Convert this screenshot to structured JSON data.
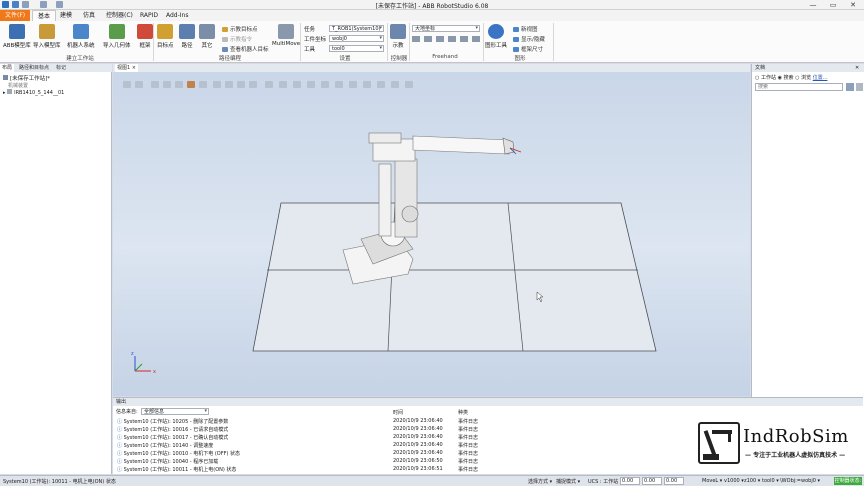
{
  "app": {
    "title": "[未保存工作站] - ABB RobotStudio 6.08"
  },
  "window": {
    "minimize": "—",
    "restore": "▭",
    "close": "✕"
  },
  "tabs": [
    "文件(F)",
    "基本",
    "建模",
    "仿真",
    "控制器(C)",
    "RAPID",
    "Add-Ins"
  ],
  "ribbon": {
    "buttons": {
      "abb_library": "ABB模型库",
      "import_library": "导入模型库",
      "robot_system": "机器人系统",
      "import_geometry": "导入几何体",
      "frame": "框架",
      "target": "目标点",
      "path": "路径",
      "other": "其它",
      "multimove": "MultiMove",
      "teach": "示教",
      "graphics_tools": "图形工具"
    },
    "small": {
      "teach_target": "示教目标点",
      "teach_instruction": "示教指令",
      "view_robot_target": "查看机器人目标",
      "new_view": "新视图",
      "show_hide": "显示/隐藏",
      "frame_size": "框架尺寸"
    },
    "settings": {
      "task_label": "任务",
      "task_value": "T_ROB1(System10)",
      "wobj_label": "工件坐标",
      "wobj_value": "wobj0",
      "tool_label": "工具",
      "tool_value": "tool0"
    },
    "freehand": {
      "frame_value": "大地坐标"
    },
    "groups": {
      "build": "建立工作站",
      "path": "路径编程",
      "settings": "设置",
      "controller": "控制器",
      "freehand": "Freehand",
      "graphics": "图形"
    }
  },
  "left_panel": {
    "tabs": [
      "布局",
      "路径和目标点",
      "标记"
    ],
    "tree": {
      "station": "[未保存工作站]*",
      "mechanism": "机械装置",
      "robot": "IRB1410_5_144__01"
    }
  },
  "viewport": {
    "tab": "视图1"
  },
  "right_panel": {
    "title": "文档",
    "radio_station": "工作站",
    "radio_browse": "搜索",
    "radio_search": "浏览",
    "location": "位置...",
    "search_placeholder": "搜索"
  },
  "output": {
    "title": "输出",
    "filter_label": "信息来自:",
    "filter_value": "全部信息",
    "col_time": "时间",
    "col_type": "种类",
    "rows": [
      {
        "msg": "System10 (工作站): 10205 - 删除了配置参数",
        "time": "2020/10/9 23:06:40",
        "type": "事件日志"
      },
      {
        "msg": "System10 (工作站): 10016 - 已请求自动模式",
        "time": "2020/10/9 23:06:40",
        "type": "事件日志"
      },
      {
        "msg": "System10 (工作站): 10017 - 已确认自动模式",
        "time": "2020/10/9 23:06:40",
        "type": "事件日志"
      },
      {
        "msg": "System10 (工作站): 10140 - 调整速度",
        "time": "2020/10/9 23:06:40",
        "type": "事件日志"
      },
      {
        "msg": "System10 (工作站): 10010 - 电机下电 (OFF) 状态",
        "time": "2020/10/9 23:06:40",
        "type": "事件日志"
      },
      {
        "msg": "System10 (工作站): 10040 - 程序已加载",
        "time": "2020/10/9 23:06:50",
        "type": "事件日志"
      },
      {
        "msg": "System10 (工作站): 10011 - 电机上电(ON) 状态",
        "time": "2020/10/9 23:06:51",
        "type": "事件日志"
      }
    ]
  },
  "watermark": {
    "brand": "IndRobSim",
    "slogan": "— 专注于工业机器人虚拟仿真技术 —"
  },
  "status": {
    "left": "System10 (工作站): 10011 - 电机上电(ON) 状态",
    "select_mode": "选择方式 ▾",
    "snap_mode": "捕捉模式 ▾",
    "ucs": "UCS : 工作站",
    "x": "0.00",
    "y": "0.00",
    "z": "0.00",
    "move": "MoveL ▾",
    "speed": "v1000 ▾",
    "zone": "z100 ▾",
    "tool": "tool0 ▾",
    "wobj": "\\WObj:=wobj0 ▾",
    "ctrl_status": "控制器状态:"
  }
}
